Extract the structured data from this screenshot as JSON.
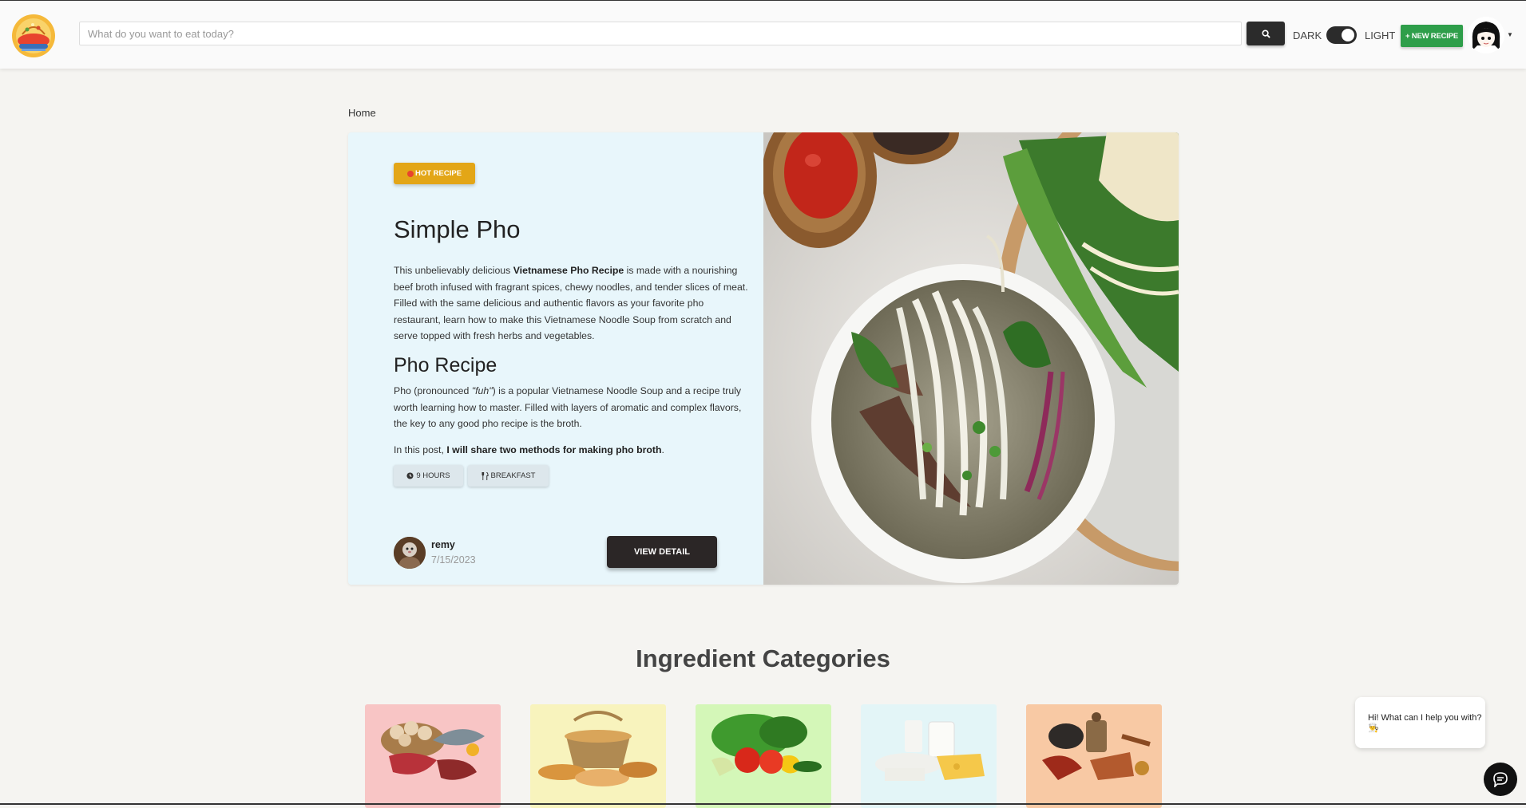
{
  "header": {
    "search_placeholder": "What do you want to eat today?",
    "dark_label": "DARK",
    "light_label": "LIGHT",
    "new_recipe_label": "+ NEW RECIPE",
    "theme_mode": "light"
  },
  "breadcrumb": {
    "home": "Home"
  },
  "hero": {
    "badge": "HOT RECIPE",
    "title": "Simple Pho",
    "desc_before": "This unbelievably delicious ",
    "desc_bold": "Vietnamese Pho Recipe",
    "desc_after": " is made with a nourishing beef broth infused with fragrant spices, chewy noodles, and tender slices of meat. Filled with the same delicious and authentic flavors as your favorite pho restaurant, learn how to make this Vietnamese Noodle Soup from scratch and serve topped with fresh herbs and vegetables.",
    "subheading": "Pho Recipe",
    "desc2_before": "Pho (pronounced ",
    "desc2_italic": "\"fuh\"",
    "desc2_after": ") is a popular Vietnamese Noodle Soup and a recipe truly worth learning how to master. Filled with layers of aromatic and complex flavors, the key to any good pho recipe is the broth.",
    "desc3_before": "In this post, ",
    "desc3_bold": "I will share two methods for making pho broth",
    "desc3_after": ".",
    "time_chip": "9 HOURS",
    "meal_chip": "BREAKFAST",
    "author": "remy",
    "date": "7/15/2023",
    "view_label": "VIEW DETAIL"
  },
  "categories": {
    "title": "Ingredient Categories",
    "cards": [
      {
        "icon": "meat-fish-eggs-image",
        "bg": "#f8c5c5"
      },
      {
        "icon": "bread-basket-image",
        "bg": "#f8f3bd"
      },
      {
        "icon": "vegetables-image",
        "bg": "#d4f7b8"
      },
      {
        "icon": "dairy-image",
        "bg": "#e3f5f7"
      },
      {
        "icon": "spices-image",
        "bg": "#f8c9a4"
      }
    ]
  },
  "chat": {
    "greeting": "Hi! What can I help you with? 👨‍🍳"
  },
  "colors": {
    "accent_green": "#2e9e4a",
    "badge_yellow": "#e3a617",
    "dark": "#2b2626",
    "hero_bg": "#e8f6fb"
  }
}
